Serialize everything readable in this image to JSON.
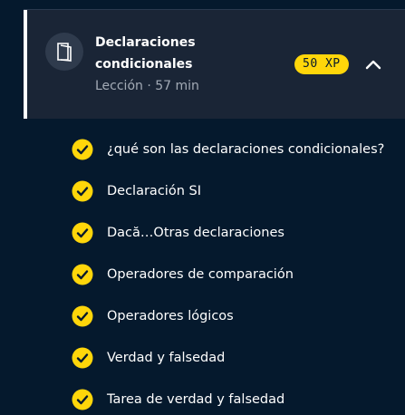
{
  "chapter": {
    "title": "Declaraciones condicionales",
    "meta": "Lección · 57 min",
    "xp": "50 XP",
    "icon": "book-icon",
    "expanded": true
  },
  "lessons": [
    {
      "label": "¿qué son las declaraciones condicionales?",
      "completed": true
    },
    {
      "label": "Declaración SI",
      "completed": true
    },
    {
      "label": "Dacă…Otras declaraciones",
      "completed": true
    },
    {
      "label": "Operadores de comparación",
      "completed": true
    },
    {
      "label": "Operadores lógicos",
      "completed": true
    },
    {
      "label": "Verdad y falsedad",
      "completed": true
    },
    {
      "label": "Tarea de verdad y falsedad",
      "completed": true
    }
  ],
  "colors": {
    "background": "#05192d",
    "card": "#1a2536",
    "accent": "#ffd60a"
  }
}
